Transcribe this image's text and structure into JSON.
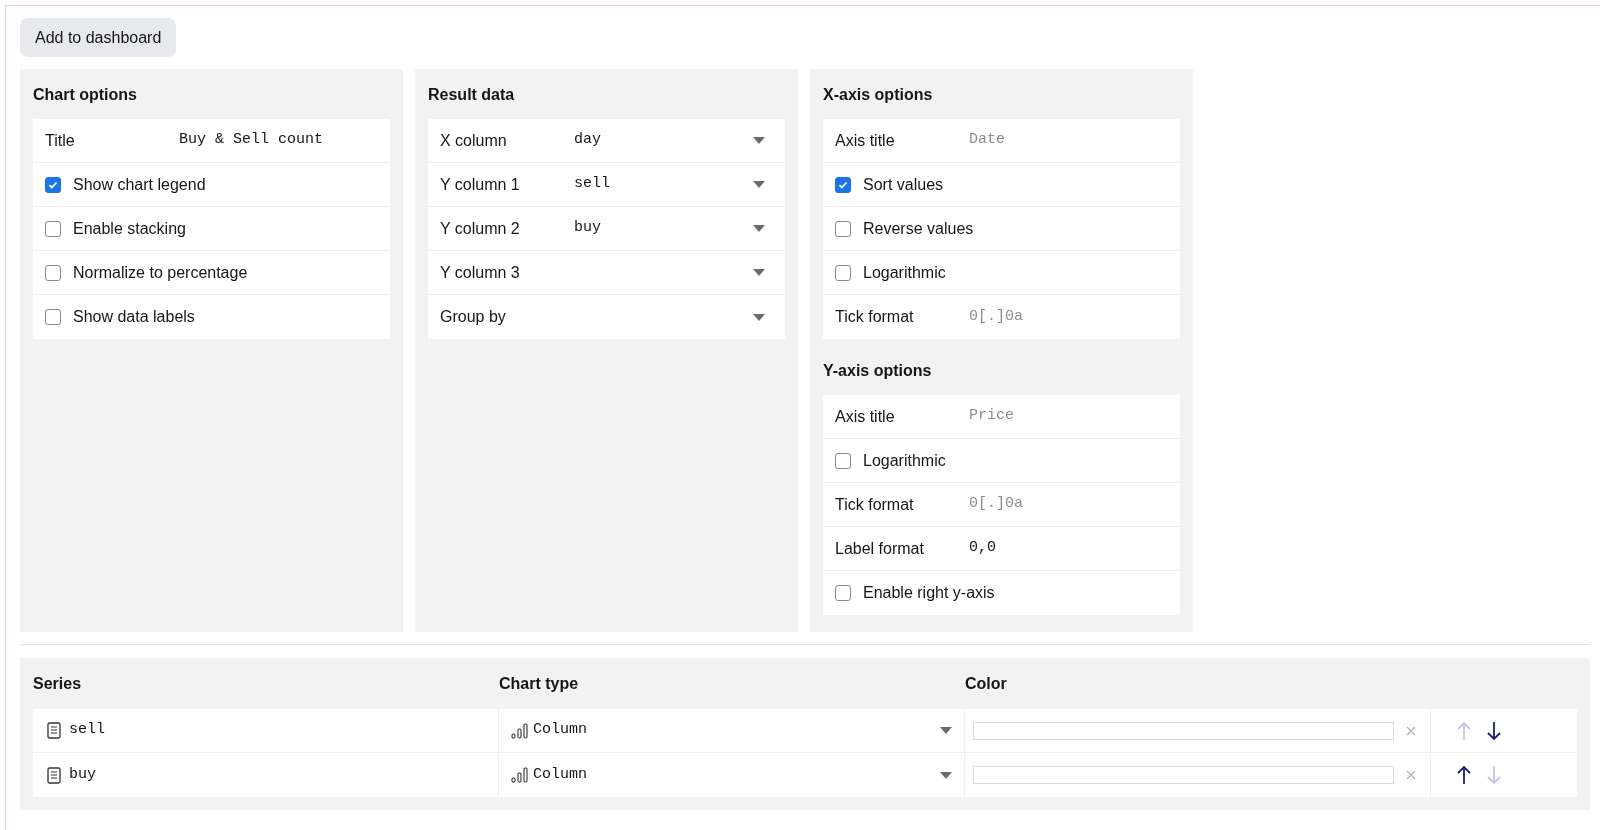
{
  "toolbar": {
    "add_button": "Add to dashboard"
  },
  "panels": [
    {
      "sections": [
        {
          "title": "Chart options",
          "rows": [
            {
              "kind": "text",
              "label": "Title",
              "value": "Buy & Sell count"
            },
            {
              "kind": "checkbox",
              "label": "Show chart legend",
              "checked": true
            },
            {
              "kind": "checkbox",
              "label": "Enable stacking",
              "checked": false
            },
            {
              "kind": "checkbox",
              "label": "Normalize to percentage",
              "checked": false
            },
            {
              "kind": "checkbox",
              "label": "Show data labels",
              "checked": false
            }
          ]
        }
      ]
    },
    {
      "sections": [
        {
          "title": "Result data",
          "rows": [
            {
              "kind": "select",
              "label": "X column",
              "value": "day"
            },
            {
              "kind": "select",
              "label": "Y column 1",
              "value": "sell"
            },
            {
              "kind": "select",
              "label": "Y column 2",
              "value": "buy"
            },
            {
              "kind": "select",
              "label": "Y column 3"
            },
            {
              "kind": "select",
              "label": "Group by"
            }
          ]
        }
      ]
    },
    {
      "sections": [
        {
          "title": "X-axis options",
          "rows": [
            {
              "kind": "text",
              "label": "Axis title",
              "placeholder": "Date"
            },
            {
              "kind": "checkbox",
              "label": "Sort values",
              "checked": true
            },
            {
              "kind": "checkbox",
              "label": "Reverse values",
              "checked": false
            },
            {
              "kind": "checkbox",
              "label": "Logarithmic",
              "checked": false
            },
            {
              "kind": "text",
              "label": "Tick format",
              "placeholder": "0[.]0a"
            }
          ]
        },
        {
          "title": "Y-axis options",
          "rows": [
            {
              "kind": "text",
              "label": "Axis title",
              "placeholder": "Price"
            },
            {
              "kind": "checkbox",
              "label": "Logarithmic",
              "checked": false
            },
            {
              "kind": "text",
              "label": "Tick format",
              "placeholder": "0[.]0a"
            },
            {
              "kind": "text",
              "label": "Label format",
              "value": "0,0"
            },
            {
              "kind": "checkbox",
              "label": "Enable right y-axis",
              "checked": false
            }
          ]
        }
      ]
    }
  ],
  "series_table": {
    "columns": [
      "Series",
      "Chart type",
      "Color"
    ],
    "rows": [
      {
        "name": "sell",
        "chart_type": "Column",
        "move_up_disabled": true,
        "move_down_disabled": false
      },
      {
        "name": "buy",
        "chart_type": "Column",
        "move_up_disabled": false,
        "move_down_disabled": true
      }
    ]
  }
}
